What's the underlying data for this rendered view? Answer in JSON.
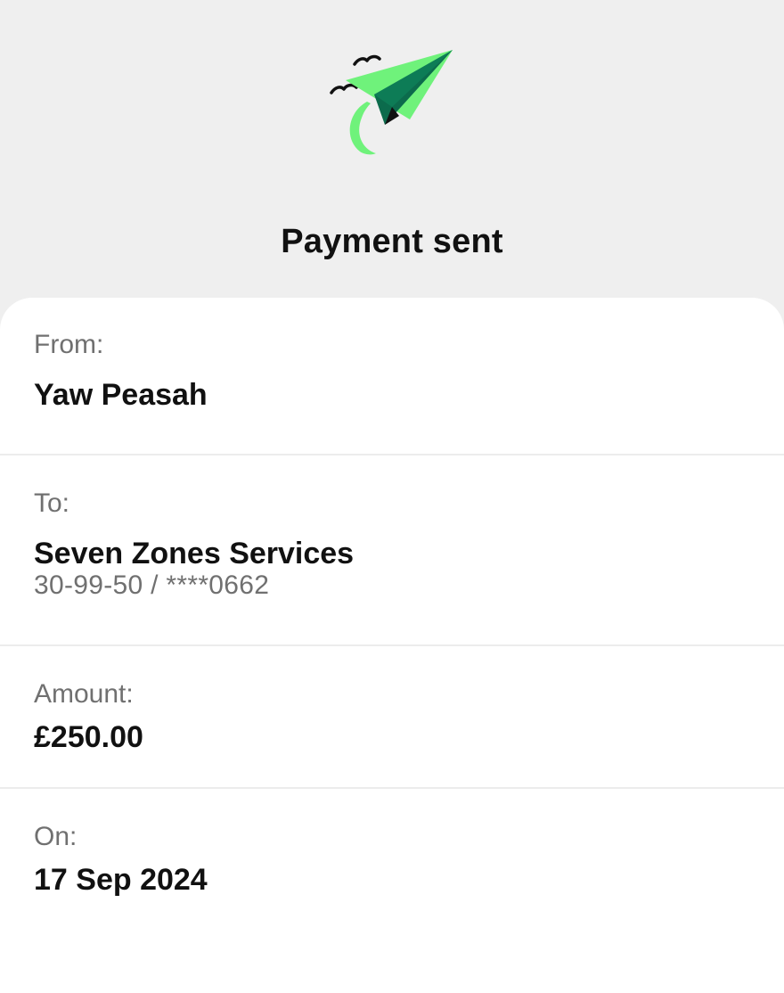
{
  "header": {
    "title": "Payment sent",
    "illustration_icon": "paper-plane-with-birds-icon",
    "accent_color": "#6ff27b",
    "accent_dark_color": "#0c6b4c"
  },
  "details": {
    "from": {
      "label": "From:",
      "value": "Yaw Peasah"
    },
    "to": {
      "label": "To:",
      "value": "Seven Zones Services",
      "account": "30-99-50 / ****0662"
    },
    "amount": {
      "label": "Amount:",
      "value": "£250.00"
    },
    "date": {
      "label": "On:",
      "value": "17 Sep 2024"
    }
  }
}
